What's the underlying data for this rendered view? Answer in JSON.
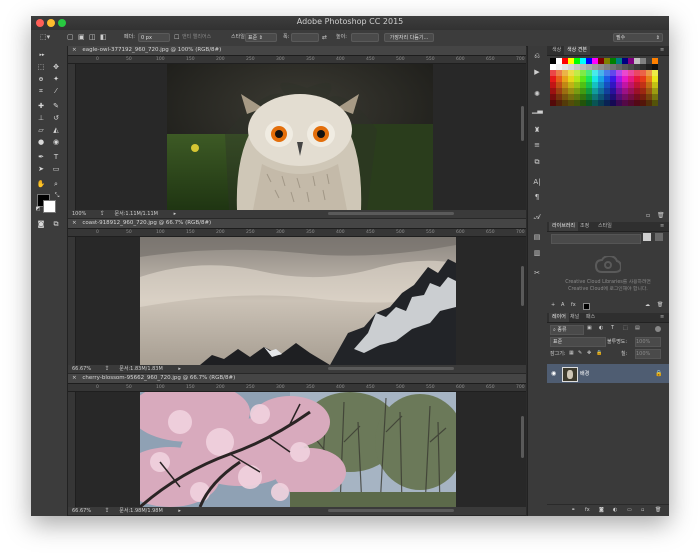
{
  "app": {
    "title": "Adobe Photoshop CC 2015"
  },
  "colors": {
    "red": "#ff5f57",
    "yellow": "#febc2e",
    "green": "#28c840",
    "selected_layer": "#4f5d72"
  },
  "options_bar": {
    "feather_label": "페더:",
    "feather_value": "0 px",
    "antialias_label": "앤티 앨리어스",
    "style_label": "스타일:",
    "style_value": "표준",
    "width_label": "폭:",
    "height_label": "높이:",
    "refine_button": "가장자리 다듬기...",
    "workspace_value": "필수"
  },
  "documents": [
    {
      "tab": "eagle-owl-377192_960_720.jpg @ 100% (RGB/8#)",
      "zoom": "100%",
      "status": "문서:1.11M/1.11M"
    },
    {
      "tab": "coast-918912_960_720.jpg @ 66.7% (RGB/8#)",
      "zoom": "66.67%",
      "status": "문서:1.83M/1.83M"
    },
    {
      "tab": "cherry-blossom-95662_960_720.jpg @ 66.7% (RGB/8#)",
      "zoom": "66.67%",
      "status": "문서:1.98M/1.98M"
    }
  ],
  "ruler_ticks": [
    "0",
    "50",
    "100",
    "150",
    "200",
    "250",
    "300",
    "350",
    "400",
    "450",
    "500",
    "550",
    "600",
    "650",
    "700"
  ],
  "swatches_panel": {
    "tabs": [
      "색상",
      "색상 견본"
    ]
  },
  "libraries_panel": {
    "tabs": [
      "라이브러리",
      "조정",
      "스타일"
    ],
    "message_line1": "Creative Cloud Libraries를 사용하려면",
    "message_line2": "Creative Cloud에 로그인해야 합니다."
  },
  "layers_panel": {
    "tabs": [
      "레이어",
      "채널",
      "패스"
    ],
    "filter_label": "종류",
    "blend_mode": "표준",
    "opacity_label": "불투명도:",
    "opacity_value": "100%",
    "lock_label": "잠그기:",
    "fill_label": "칠:",
    "fill_value": "100%",
    "layer_name": "배경"
  }
}
